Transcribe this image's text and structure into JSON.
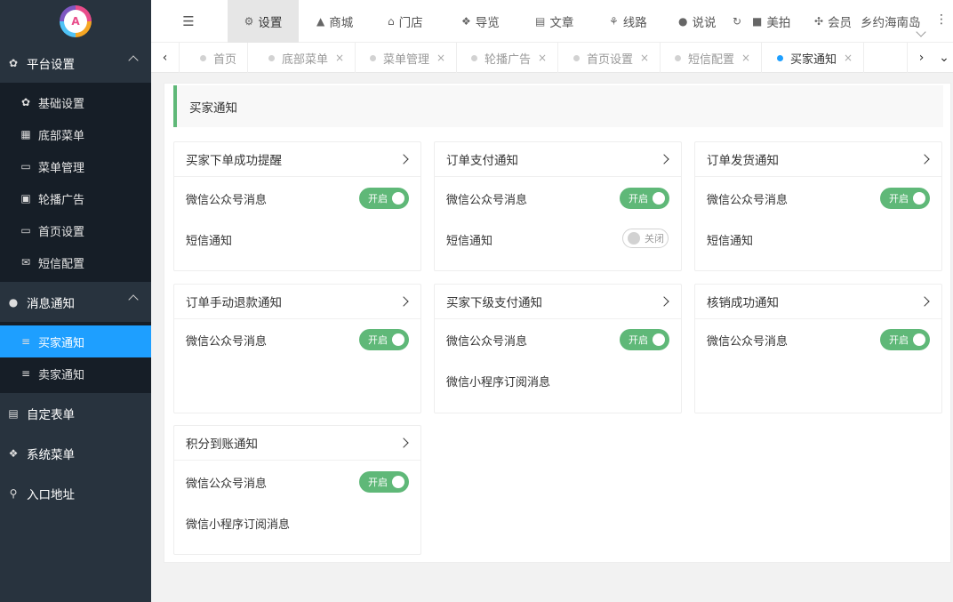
{
  "logo": {
    "text": "A"
  },
  "sidebar": {
    "groups": [
      {
        "label": "平台设置",
        "icon": "gear-icon",
        "items": [
          {
            "label": "基础设置",
            "icon": "gear-icon"
          },
          {
            "label": "底部菜单",
            "icon": "grid-icon"
          },
          {
            "label": "菜单管理",
            "icon": "monitor-icon"
          },
          {
            "label": "轮播广告",
            "icon": "image-icon"
          },
          {
            "label": "首页设置",
            "icon": "monitor-icon"
          },
          {
            "label": "短信配置",
            "icon": "mail-icon"
          }
        ]
      },
      {
        "label": "消息通知",
        "icon": "chat-icon",
        "items": [
          {
            "label": "买家通知",
            "icon": "list-icon",
            "active": true
          },
          {
            "label": "卖家通知",
            "icon": "list-icon"
          }
        ]
      },
      {
        "label": "自定表单",
        "icon": "form-icon"
      },
      {
        "label": "系统菜单",
        "icon": "cubes-icon"
      },
      {
        "label": "入口地址",
        "icon": "search-icon"
      }
    ]
  },
  "topbar": {
    "items": [
      {
        "label": "设置",
        "icon": "gears-icon",
        "active": true
      },
      {
        "label": "商城",
        "icon": "bag-icon"
      },
      {
        "label": "门店",
        "icon": "bank-icon"
      },
      {
        "label": "导览",
        "icon": "cubes-icon"
      },
      {
        "label": "文章",
        "icon": "news-icon"
      },
      {
        "label": "线路",
        "icon": "route-icon"
      },
      {
        "label": "说说",
        "icon": "wechat-icon"
      },
      {
        "label": "美拍",
        "icon": "video-icon"
      },
      {
        "label": "会员",
        "icon": "users-icon"
      }
    ],
    "site_name": "乡约海南岛"
  },
  "tabs": [
    {
      "label": "首页"
    },
    {
      "label": "底部菜单"
    },
    {
      "label": "菜单管理"
    },
    {
      "label": "轮播广告"
    },
    {
      "label": "首页设置"
    },
    {
      "label": "短信配置"
    },
    {
      "label": "买家通知",
      "active": true
    }
  ],
  "page": {
    "title": "买家通知"
  },
  "cards": [
    {
      "title": "买家下单成功提醒",
      "rows": [
        {
          "label": "微信公众号消息",
          "switch": "开启",
          "on": true
        },
        {
          "label": "短信通知"
        }
      ]
    },
    {
      "title": "订单支付通知",
      "rows": [
        {
          "label": "微信公众号消息",
          "switch": "开启",
          "on": true
        },
        {
          "label": "短信通知",
          "switch": "关闭",
          "on": false
        }
      ]
    },
    {
      "title": "订单发货通知",
      "rows": [
        {
          "label": "微信公众号消息",
          "switch": "开启",
          "on": true
        },
        {
          "label": "短信通知"
        }
      ]
    },
    {
      "title": "订单手动退款通知",
      "rows": [
        {
          "label": "微信公众号消息",
          "switch": "开启",
          "on": true
        }
      ]
    },
    {
      "title": "买家下级支付通知",
      "rows": [
        {
          "label": "微信公众号消息",
          "switch": "开启",
          "on": true
        },
        {
          "label": "微信小程序订阅消息"
        }
      ]
    },
    {
      "title": "核销成功通知",
      "rows": [
        {
          "label": "微信公众号消息",
          "switch": "开启",
          "on": true
        }
      ]
    },
    {
      "title": "积分到账通知",
      "rows": [
        {
          "label": "微信公众号消息",
          "switch": "开启",
          "on": true
        },
        {
          "label": "微信小程序订阅消息"
        }
      ]
    }
  ]
}
